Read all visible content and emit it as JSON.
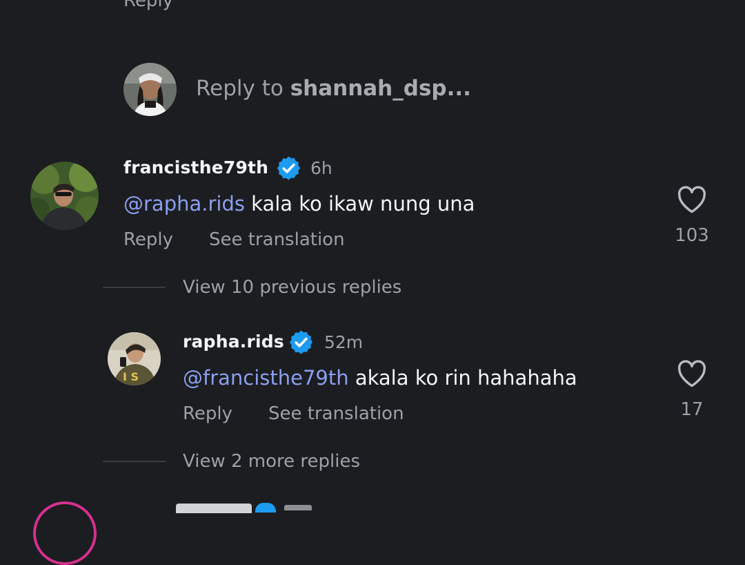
{
  "top": {
    "reply_label": "Reply"
  },
  "composer": {
    "prompt_prefix": "Reply to ",
    "prompt_target": "shannah_dsp..."
  },
  "comments": [
    {
      "username": "francisthe79th",
      "time": "6h",
      "mention": "@rapha.rids",
      "text": " kala ko ikaw nung una",
      "reply_label": "Reply",
      "translate_label": "See translation",
      "likes": "103"
    },
    {
      "username": "rapha.rids",
      "time": "52m",
      "mention": "@francisthe79th",
      "text": " akala ko rin hahahaha",
      "reply_label": "Reply",
      "translate_label": "See translation",
      "likes": "17"
    }
  ],
  "thread": {
    "view_previous": "View 10 previous replies",
    "view_more": "View 2 more replies"
  },
  "colors": {
    "background": "#1b1d20",
    "mention": "#8b9ff0",
    "verified": "#1d9bf0",
    "muted": "#9da1a7"
  }
}
